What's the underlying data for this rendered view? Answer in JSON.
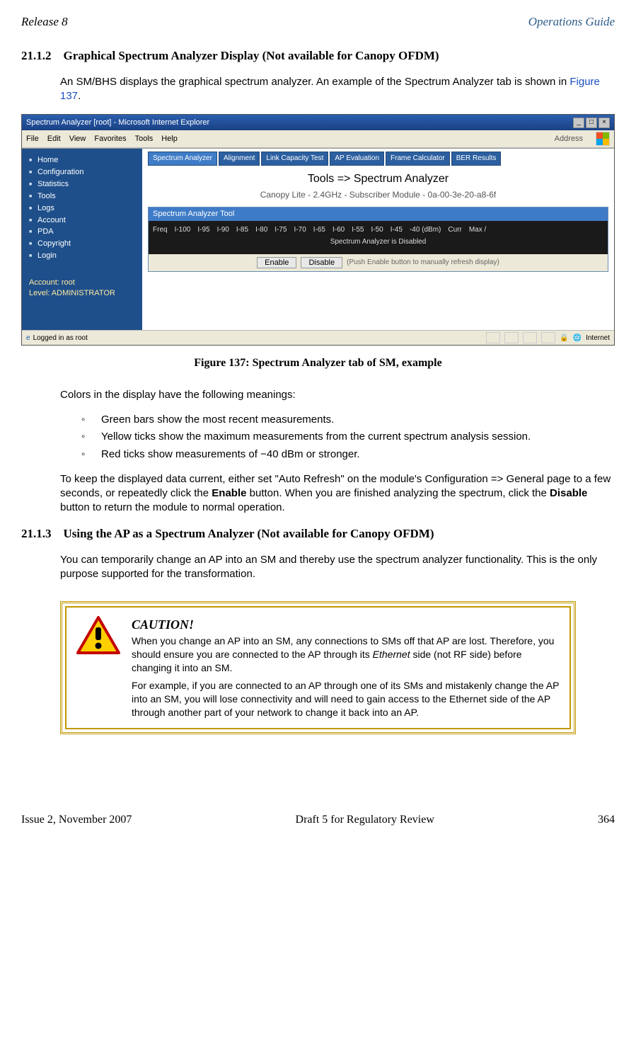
{
  "header": {
    "left": "Release 8",
    "right": "Operations Guide"
  },
  "section1": {
    "number": "21.1.2",
    "title": "Graphical Spectrum Analyzer Display (Not available for Canopy OFDM)",
    "intro_a": "An SM/BHS displays the graphical spectrum analyzer. An example of the Spectrum Analyzer tab is shown in ",
    "intro_link": "Figure 137",
    "intro_b": "."
  },
  "screenshot": {
    "window_title": "Spectrum Analyzer [root] - Microsoft Internet Explorer",
    "menus": [
      "File",
      "Edit",
      "View",
      "Favorites",
      "Tools",
      "Help"
    ],
    "address_label": "Address",
    "sidebar_items": [
      "Home",
      "Configuration",
      "Statistics",
      "Tools",
      "Logs",
      "Account",
      "PDA",
      "Copyright",
      "Login"
    ],
    "acct_line1": "Account: root",
    "acct_line2": "Level: ADMINISTRATOR",
    "tabs": [
      "Spectrum Analyzer",
      "Alignment",
      "Link Capacity Test",
      "AP Evaluation",
      "Frame Calculator",
      "BER Results"
    ],
    "main_title": "Tools => Spectrum Analyzer",
    "sub_title": "Canopy Lite - 2.4GHz - Subscriber Module - 0a-00-3e-20-a8-6f",
    "panel_header": "Spectrum Analyzer Tool",
    "cols": [
      "Freq",
      "I-100",
      "I-95",
      "I-90",
      "I-85",
      "I-80",
      "I-75",
      "I-70",
      "I-65",
      "I-60",
      "I-55",
      "I-50",
      "I-45",
      "-40 (dBm)",
      "Curr",
      "Max /"
    ],
    "disabled_text": "Spectrum Analyzer is Disabled",
    "btn_enable": "Enable",
    "btn_disable": "Disable",
    "hint": "(Push Enable button to manually refresh display)",
    "status_left": "Logged in as root",
    "status_right": "Internet"
  },
  "figure_caption": "Figure 137: Spectrum Analyzer tab of SM, example",
  "colors_intro": "Colors in the display have the following meanings:",
  "color_bullets": [
    "Green bars show the most recent measurements.",
    "Yellow ticks show the maximum measurements from the current spectrum analysis session.",
    "Red ticks show measurements of −40 dBm or stronger."
  ],
  "keep_current_a": "To keep the displayed data current, either set \"Auto Refresh\" on the module's Configuration => General page to a few seconds, or repeatedly click the ",
  "keep_current_enable": "Enable",
  "keep_current_b": " button. When you are finished analyzing the spectrum, click the ",
  "keep_current_disable": "Disable",
  "keep_current_c": " button to return the module to normal operation.",
  "section2": {
    "number": "21.1.3",
    "title": "Using the AP as a Spectrum Analyzer  (Not available for Canopy OFDM)",
    "body": "You can temporarily change an AP into an SM and thereby use the spectrum analyzer functionality. This is the only purpose supported for the transformation."
  },
  "caution": {
    "title": "CAUTION!",
    "p1a": "When you change an AP into an SM, any connections to SMs off that AP are lost. Therefore, you should ensure you are connected to the AP through its ",
    "p1_italic": "Ethernet",
    "p1b": " side (not RF side) before changing it into an SM.",
    "p2": "For example, if you are connected to an AP through one of its SMs and mistakenly change the AP into an SM, you will lose connectivity and will need to gain access to the Ethernet side of the AP through another part of your network to change it back into an AP."
  },
  "footer": {
    "left": "Issue 2, November 2007",
    "center": "Draft 5 for Regulatory Review",
    "right": "364"
  }
}
